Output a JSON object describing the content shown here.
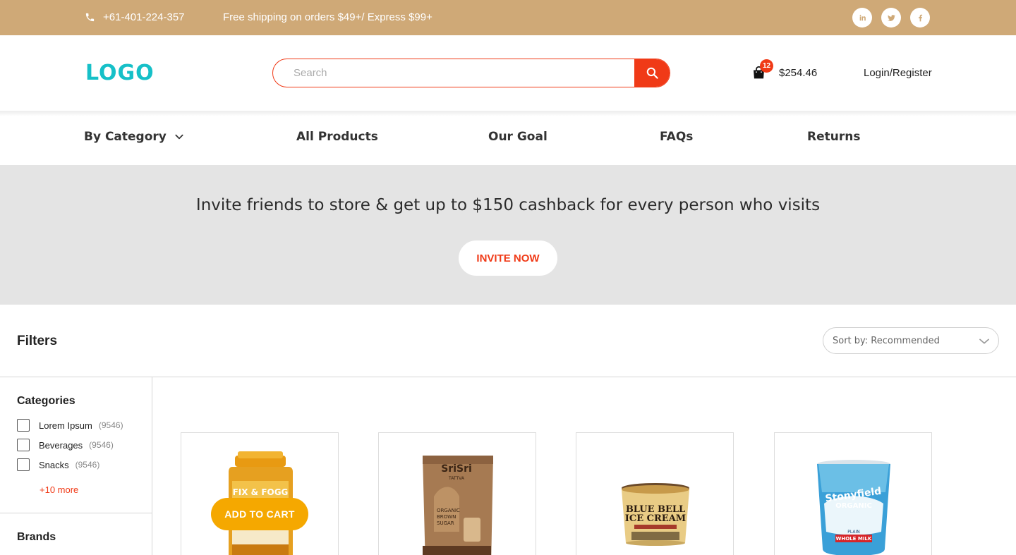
{
  "topbar": {
    "phone": "+61-401-224-357",
    "shipping": "Free shipping on orders $49+/ Express $99+",
    "socials": [
      "linkedin-icon",
      "twitter-icon",
      "facebook-icon"
    ],
    "bg_color": "#cfa977"
  },
  "header": {
    "logo": "LOGO",
    "search_placeholder": "Search",
    "cart_count": "12",
    "cart_total": "$254.46",
    "login": "Login/Register",
    "accent": "#f03a17",
    "logo_color": "#16c0c8"
  },
  "nav": {
    "items": [
      "By Category",
      "All Products",
      "Our Goal",
      "FAQs",
      "Returns"
    ]
  },
  "banner": {
    "headline": "Invite friends to store & get up to $150 cashback for every person who visits",
    "cta": "INVITE NOW"
  },
  "filters": {
    "title": "Filters",
    "sort_label": "Sort by: Recommended"
  },
  "sidebar": {
    "categories_heading": "Categories",
    "categories": [
      {
        "label": "Lorem Ipsum",
        "count": "(9546)"
      },
      {
        "label": "Beverages",
        "count": "(9546)"
      },
      {
        "label": "Snacks",
        "count": "(9546)"
      }
    ],
    "more": "+10 more",
    "brands_heading": "Brands"
  },
  "products": {
    "add_to_cart": "ADD TO CART",
    "labels": {
      "p1_brand": "FIX & FOGG",
      "p2_brand": "SriSri",
      "p2_sub": "TATTVA",
      "p2_line1": "ORGANIC",
      "p2_line2": "BROWN",
      "p2_line3": "SUGAR",
      "p3_line1": "BLUE BELL",
      "p3_line2": "ICE CREAM",
      "p4_brand": "Stonyfield",
      "p4_sub": "ORGANIC",
      "p4_plain": "PLAIN",
      "p4_type": "WHOLE MILK"
    }
  }
}
